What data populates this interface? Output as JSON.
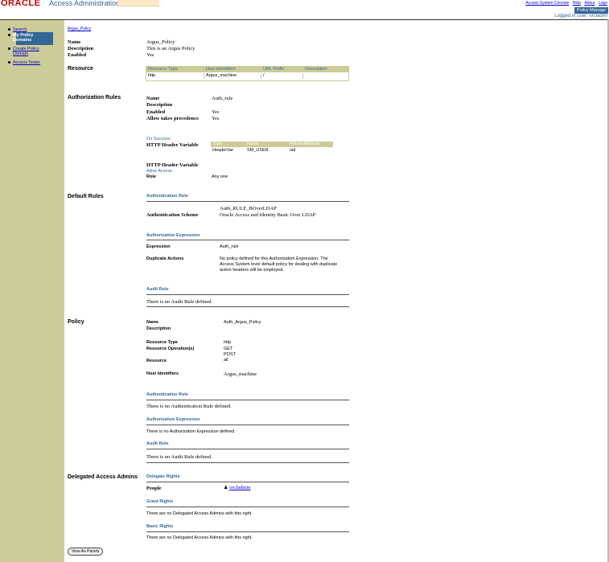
{
  "header": {
    "logo": "ORACLE",
    "title": "Access Administration",
    "links": [
      "Access System Console",
      "Help",
      "About",
      "Logo"
    ],
    "policy_button": "Policy Manage",
    "logged_in": "Logged in user: orcladmi"
  },
  "sidebar": {
    "items": [
      {
        "label": "Search"
      },
      {
        "label": "My Policy"
      },
      {
        "label": "Domains"
      },
      {
        "label": "Create Policy"
      },
      {
        "label": "Domain"
      },
      {
        "label": "Access Tester"
      }
    ]
  },
  "breadcrumb": "Argus_Policy",
  "domain": {
    "name_label": "Name",
    "name_value": "Argus_Policy",
    "description_label": "Description",
    "description_value": "This is an Argus Policy",
    "enabled_label": "Enabled",
    "enabled_value": "Yes"
  },
  "resource": {
    "section": "Resource",
    "headers": [
      "Resource Type",
      "Host Identifiers",
      "URL Prefix",
      "Description"
    ],
    "row": [
      "http",
      "Argus_machine",
      "/",
      ""
    ]
  },
  "authorization_rules": {
    "section": "Authorization Rules",
    "name_label": "Name",
    "name_value": "Auth_rule",
    "description_label": "Description",
    "enabled_label": "Enabled",
    "enabled_value": "Yes",
    "allow_label": "Allow takes precedence",
    "allow_value": "Yes",
    "on_success": "On Success",
    "http_header_label": "HTTP Header Variable",
    "header_table": {
      "headers": [
        "Type",
        "Name",
        "Return Attribute"
      ],
      "row": [
        "HeaderVar",
        "SM_USER",
        "uid"
      ]
    },
    "http_header_label2": "HTTP Header Variable",
    "allow_access": "Allow Access",
    "role_label": "Role",
    "role_value": "Any one"
  },
  "default_rules": {
    "section": "Default Rules",
    "authn_rule_title": "Authentication Rule",
    "authn_rule_value": "Auth_RULE_BOverLDAP",
    "authn_scheme_label": "Authentication Scheme",
    "authn_scheme_value": "Oracle Access and Identity Basic Over LDAP",
    "authz_expr_title": "Authorization Expression",
    "expression_label": "Expression",
    "expression_value": "Auth_rule",
    "duplicate_label": "Duplicate Actions",
    "duplicate_line1": "No policy defined for this Authorization Expression. The",
    "duplicate_line2": "Access System level default policy for dealing with duplicate",
    "duplicate_line3": "action headers will be employed.",
    "audit_title": "Audit Rule",
    "audit_value": "There is no Audit Rule defined."
  },
  "policy": {
    "section": "Policy",
    "name_label": "Name",
    "name_value": "Auth_Argus_Policy",
    "description_label": "Description",
    "rtype_label": "Resource Type",
    "rtype_value": "http",
    "rops_label": "Resource Operation(s)",
    "rops_value1": "GET",
    "rops_value2": "POST",
    "resource_label": "Resource",
    "resource_value": "all",
    "host_label": "Host Identifiers",
    "host_value": "Argus_machine",
    "authn_title": "Authentication Rule",
    "authn_value": "There is no Authentication Rule defined.",
    "authz_title": "Authorization Expression",
    "authz_value": "There is no Authorization Expression defined.",
    "audit_title": "Audit Rule",
    "audit_value": "There is no Audit Rule defined."
  },
  "delegated": {
    "section": "Delegated Access Admins",
    "delegate_title": "Delegate Rights",
    "people_label": "People",
    "people_value": "orcladmin",
    "grant_title": "Grant Rights",
    "grant_value": "There are no Delegated Access Admins with this right.",
    "basic_title": "Basic Rights",
    "basic_value": "There are no Delegated Access Admins with this right."
  },
  "button_view_panels": "View As Panels"
}
